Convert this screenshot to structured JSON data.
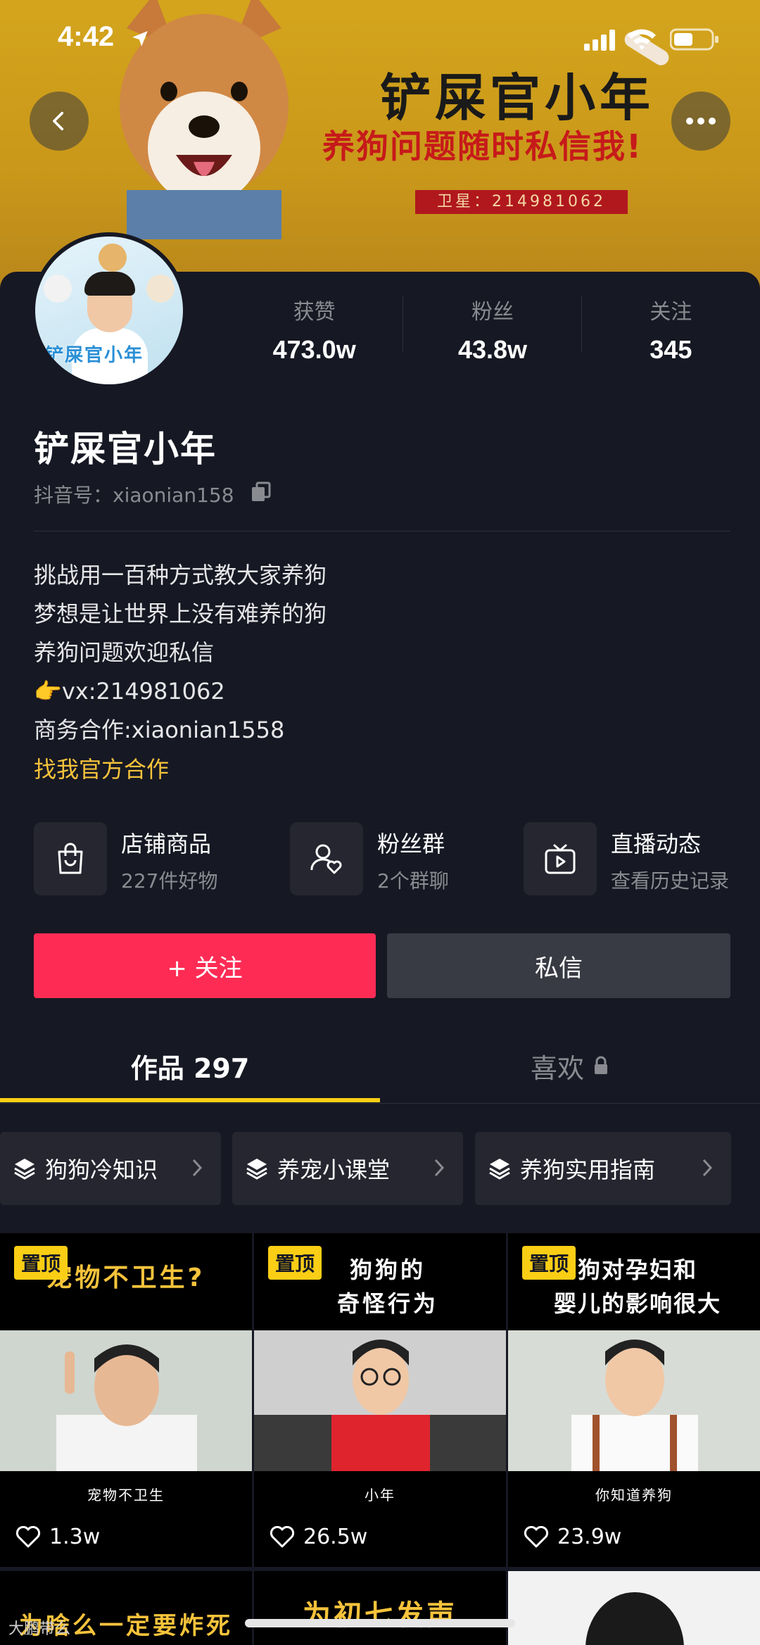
{
  "status_bar": {
    "time": "4:42"
  },
  "banner": {
    "title": "铲屎官小年",
    "subtitle": "养狗问题随时私信我!",
    "tag": "卫星：214981062"
  },
  "stats": [
    {
      "label": "获赞",
      "value": "473.0w"
    },
    {
      "label": "粉丝",
      "value": "43.8w"
    },
    {
      "label": "关注",
      "value": "345"
    }
  ],
  "avatar_text": "铲屎官小年",
  "profile": {
    "name": "铲屎官小年",
    "uid": "抖音号：xiaonian158"
  },
  "bio": {
    "lines": [
      "挑战用一百种方式教大家养狗",
      "梦想是让世界上没有难养的狗",
      "养狗问题欢迎私信"
    ],
    "vx_emoji": "👉",
    "vx": "vx:214981062",
    "business": "商务合作:xiaonian1558",
    "cooperate_link": "找我官方合作"
  },
  "features": [
    {
      "icon": "shopping-bag-icon",
      "title": "店铺商品",
      "sub": "227件好物"
    },
    {
      "icon": "fan-group-icon",
      "title": "粉丝群",
      "sub": "2个群聊"
    },
    {
      "icon": "live-tv-icon",
      "title": "直播动态",
      "sub": "查看历史记录"
    }
  ],
  "actions": {
    "follow": "+ 关注",
    "message": "私信"
  },
  "tabs": [
    {
      "label": "作品 297",
      "active": true
    },
    {
      "label": "喜欢",
      "locked": true
    }
  ],
  "collections": [
    {
      "label": "狗狗冷知识"
    },
    {
      "label": "养宠小课堂"
    },
    {
      "label": "养狗实用指南"
    }
  ],
  "videos": [
    {
      "pin": "置顶",
      "top_caption": "宠物不卫生?",
      "sub_caption": "宠物不卫生",
      "likes": "1.3w"
    },
    {
      "pin": "置顶",
      "top_caption": "狗狗的\n奇怪行为",
      "sub_caption": "小年",
      "likes": "26.5w"
    },
    {
      "pin": "置顶",
      "top_caption": "狗对孕妇和\n婴儿的影响很大",
      "sub_caption": "你知道养狗",
      "likes": "23.9w"
    }
  ],
  "row2_captions": [
    "为啥么一定要炸死",
    "为初七发声",
    ""
  ],
  "watermark": "大鹏带么",
  "colors": {
    "accent_red": "#fe2c55",
    "accent_yellow": "#face15",
    "bg": "#161823"
  }
}
